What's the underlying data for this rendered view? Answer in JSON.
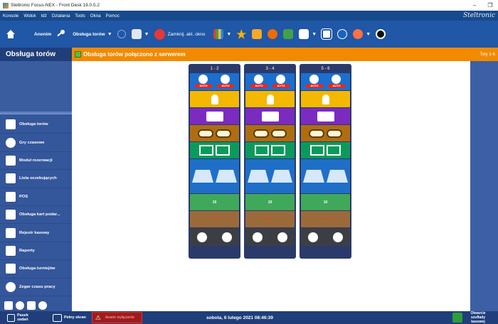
{
  "window": {
    "title": "Steltronic Focus-NEX - Front Desk 19.0.5.2",
    "minimize": "–",
    "restore": "❐"
  },
  "menu": {
    "items": [
      "Konsole",
      "Widok",
      "Idź",
      "Działania",
      "Tools",
      "Okna",
      "Pomoc"
    ],
    "brand": "Steltronic"
  },
  "toolbar": {
    "user": "Anonim",
    "lanes_menu": "Obsługa torów",
    "close_window": "Zamknij. akt. okno"
  },
  "sidebar": {
    "title": "Obsługa torów",
    "items": [
      {
        "label": "Obsługa torów",
        "icon": "lanes-icon"
      },
      {
        "label": "Gry czasowe",
        "icon": "timer-icon"
      },
      {
        "label": "Moduł rezerwacji",
        "icon": "reservation-icon"
      },
      {
        "label": "Lista oczekujących",
        "icon": "waiting-list-icon"
      },
      {
        "label": "POS",
        "icon": "pos-icon"
      },
      {
        "label": "Obsługa kart podar...",
        "icon": "gift-card-icon"
      },
      {
        "label": "Rejestr kasowy",
        "icon": "cash-register-icon"
      },
      {
        "label": "Raporty",
        "icon": "reports-icon"
      },
      {
        "label": "Obsługa turniejów",
        "icon": "trophy-icon"
      },
      {
        "label": "Zegar czasu pracy",
        "icon": "clock-icon"
      }
    ]
  },
  "header": {
    "status_text": "Obsługa torów połączono z serwerem",
    "right_text": "Tory 1-6"
  },
  "lanes": [
    {
      "label": "1 - 2",
      "auto_text": "AUTO",
      "pins_count": "10"
    },
    {
      "label": "3 - 4",
      "auto_text": "AUTO",
      "pins_count": "10"
    },
    {
      "label": "5 - 6",
      "auto_text": "AUTO",
      "pins_count": "10"
    }
  ],
  "bottom": {
    "pasek_label": "Pasek zadań",
    "fullscreen_label": "Pełny ekran",
    "alarm_label": "Awarie wyłączenie",
    "datetime": "sobota, 6 lutego 2021 08:46:39",
    "drawer_label": "Otwarcie szuflady kasowej"
  },
  "colors": {
    "accent_orange": "#f28a00",
    "toolbar_blue": "#2057a6",
    "sidebar_blue": "#34569a"
  }
}
